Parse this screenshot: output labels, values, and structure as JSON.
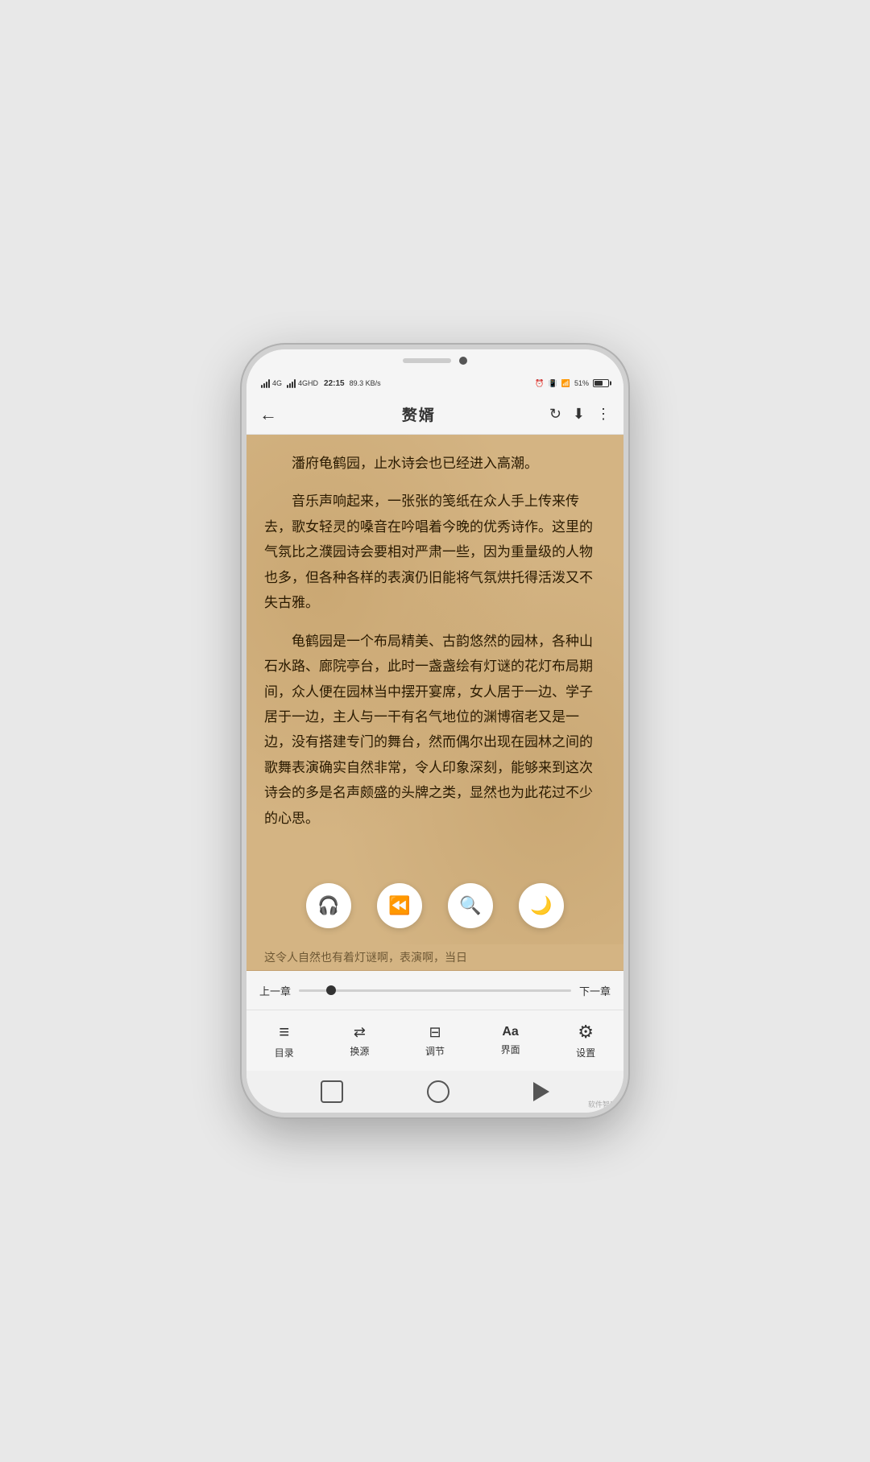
{
  "status": {
    "network": "4G",
    "network2": "4GHD",
    "time": "22:15",
    "speed": "89.3 KB/s",
    "battery": "51%",
    "wifi": "WiFi"
  },
  "nav": {
    "back_icon": "←",
    "title": "赘婿",
    "refresh_icon": "↻",
    "download_icon": "⬇",
    "more_icon": "⋮"
  },
  "content": {
    "paragraph1": "潘府龟鹤园，止水诗会也已经进入高潮。",
    "paragraph2": "音乐声响起来，一张张的笺纸在众人手上传来传去，歌女轻灵的嗓音在吟唱着今晚的优秀诗作。这里的气氛比之濮园诗会要相对严肃一些，因为重量级的人物也多，但各种各样的表演仍旧能将气氛烘托得活泼又不失古雅。",
    "paragraph3": "龟鹤园是一个布局精美、古韵悠然的园林，各种山石水路、廊院亭台，此时一盏盏绘有灯谜的花灯布局期间，众人便在园林当中摆开宴席，女人居于一边、学子居于一边，主人与一干有名气地位的渊博宿老又是一边，没有搭建专门的舞台，然而偶尔出现在园林之间的歌舞表演确实自然非常，令人印象深刻，能够来到这次诗会的多是名声颇盛的头牌之类，显然也为此花过不少的心思。",
    "faded_text": "这令人自然也有着灯谜啊，表演啊，当日"
  },
  "controls": {
    "headphone_icon": "🎧",
    "back_icon": "⏪",
    "search_icon": "🔍",
    "moon_icon": "🌙"
  },
  "progress": {
    "prev_label": "上一章",
    "next_label": "下一章"
  },
  "toolbar": {
    "items": [
      {
        "icon": "≡",
        "label": "目录"
      },
      {
        "icon": "⇄",
        "label": "换源"
      },
      {
        "icon": "⊟",
        "label": "调节"
      },
      {
        "icon": "Aa",
        "label": "界面"
      },
      {
        "icon": "⚙",
        "label": "设置"
      }
    ]
  },
  "watermark": "软件智库"
}
